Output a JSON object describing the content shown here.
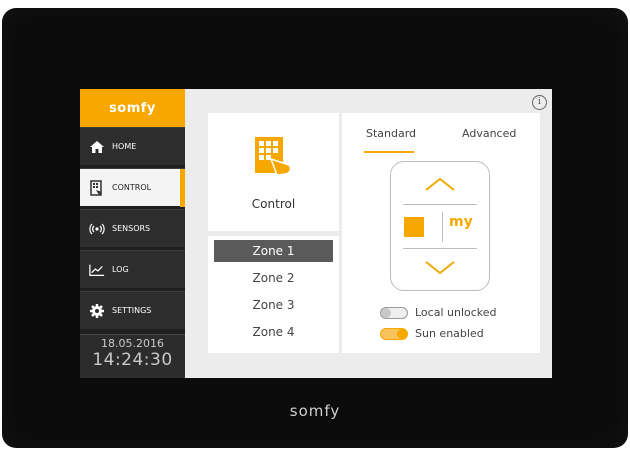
{
  "brand": {
    "logo_text": "somfy",
    "device_label": "somfy",
    "accent": "#f6a800"
  },
  "sidebar": {
    "items": [
      {
        "label": "HOME",
        "icon": "home-icon",
        "active": false
      },
      {
        "label": "CONTROL",
        "icon": "facade-control-icon",
        "active": true
      },
      {
        "label": "SENSORS",
        "icon": "sensor-signal-icon",
        "active": false
      },
      {
        "label": "LOG",
        "icon": "chart-line-icon",
        "active": false
      },
      {
        "label": "SETTINGS",
        "icon": "gear-icon",
        "active": false
      }
    ],
    "clock": {
      "date": "18.05.2016",
      "time": "14:24:30"
    }
  },
  "header": {
    "info_icon": "info-icon"
  },
  "control": {
    "label": "Control",
    "icon": "facade-control-icon"
  },
  "zones": [
    {
      "label": "Zone 1",
      "selected": true
    },
    {
      "label": "Zone 2",
      "selected": false
    },
    {
      "label": "Zone 3",
      "selected": false
    },
    {
      "label": "Zone 4",
      "selected": false
    }
  ],
  "tabs": [
    {
      "label": "Standard",
      "active": true
    },
    {
      "label": "Advanced",
      "active": false
    }
  ],
  "remote": {
    "up_icon": "chevron-up-icon",
    "stop_icon": "stop-icon",
    "my_label": "my",
    "down_icon": "chevron-down-icon"
  },
  "toggles": [
    {
      "label": "Local unlocked",
      "on": false
    },
    {
      "label": "Sun enabled",
      "on": true
    }
  ]
}
